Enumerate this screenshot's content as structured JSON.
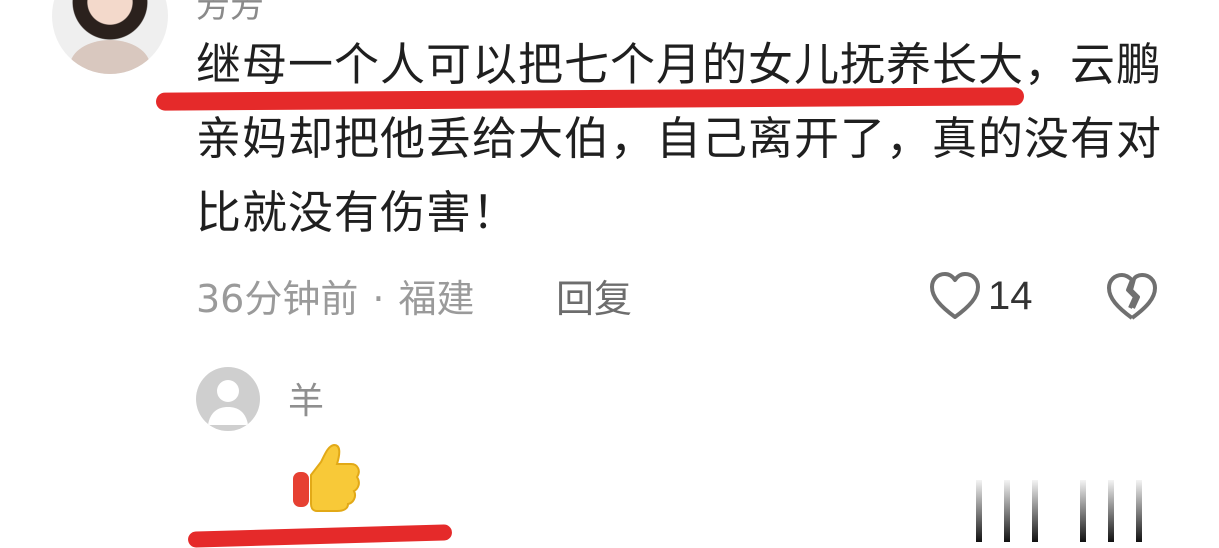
{
  "comment": {
    "username": "芳芳",
    "text": "继母一个人可以把七个月的女儿抚养长大，云鹏亲妈却把他丢给大伯，自己离开了，真的没有对比就没有伤害！",
    "time": "36分钟前",
    "separator": "·",
    "location": "福建",
    "reply_label": "回复",
    "like_count": "14",
    "icons": {
      "like": "heart-outline-icon",
      "dislike": "broken-heart-icon"
    },
    "colors": {
      "underline": "#e52a2a",
      "text": "#1f1f1f",
      "meta": "#9a9a9a"
    }
  },
  "sub_comment": {
    "username": "羊",
    "emoji": "thumbs-up-icon"
  }
}
